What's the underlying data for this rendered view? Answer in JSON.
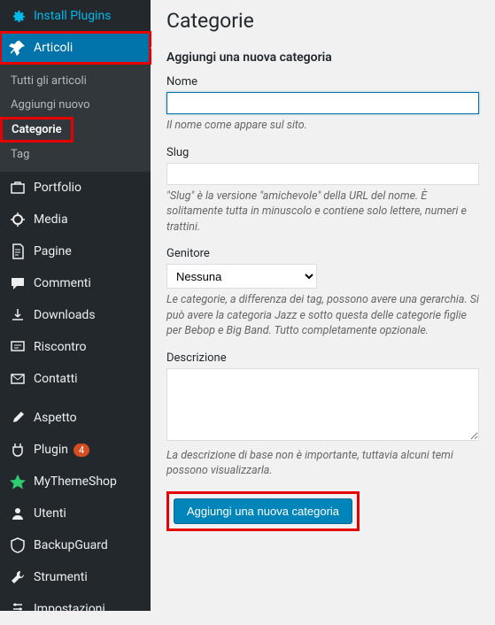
{
  "sidebar": {
    "installPlugins": "Install Plugins",
    "articoli": {
      "label": "Articoli",
      "sub": {
        "tutti": "Tutti gli articoli",
        "aggiungi": "Aggiungi nuovo",
        "categorie": "Categorie",
        "tag": "Tag"
      }
    },
    "portfolio": "Portfolio",
    "media": "Media",
    "pagine": "Pagine",
    "commenti": "Commenti",
    "downloads": "Downloads",
    "riscontro": "Riscontro",
    "contatti": "Contatti",
    "aspetto": "Aspetto",
    "plugin": {
      "label": "Plugin",
      "badge": "4"
    },
    "mythemeshop": "MyThemeShop",
    "utenti": "Utenti",
    "backupguard": "BackupGuard",
    "strumenti": "Strumenti",
    "impostazioni": "Impostazioni"
  },
  "page": {
    "title": "Categorie",
    "formTitle": "Aggiungi una nuova categoria",
    "name": {
      "label": "Nome",
      "value": "",
      "help": "Il nome come appare sul sito."
    },
    "slug": {
      "label": "Slug",
      "value": "",
      "help": "\"Slug\" è la versione \"amichevole\" della URL del nome. È solitamente tutta in minuscolo e contiene solo lettere, numeri e trattini."
    },
    "parent": {
      "label": "Genitore",
      "selected": "Nessuna",
      "help": "Le categorie, a differenza dei tag, possono avere una gerarchia. Si può avere la categoria Jazz e sotto questa delle categorie figlie per Bebop e Big Band. Tutto completamente opzionale."
    },
    "description": {
      "label": "Descrizione",
      "value": "",
      "help": "La descrizione di base non è importante, tuttavia alcuni temi possono visualizzarla."
    },
    "submit": "Aggiungi una nuova categoria"
  }
}
